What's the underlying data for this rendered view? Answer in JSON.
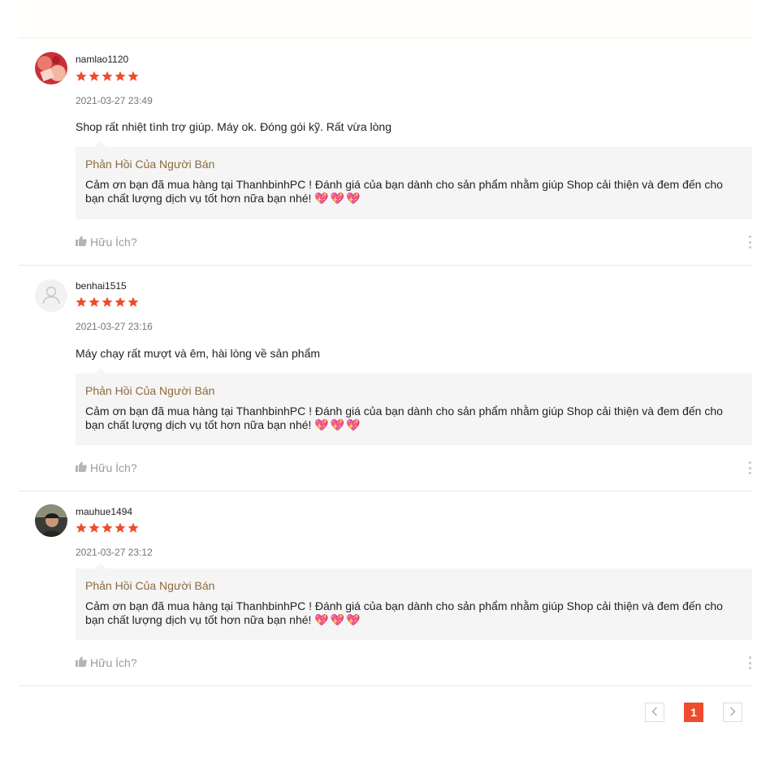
{
  "reviews": [
    {
      "username": "namlao1120",
      "rating": 5,
      "time": "2021-03-27 23:49",
      "comment": "Shop rất nhiệt tình trợ giúp. Máy ok. Đóng gói kỹ. Rất vừa lòng",
      "reply_title": "Phản Hồi Của Người Bán",
      "reply_text": "Cảm ơn bạn đã mua hàng tại ThanhbinhPC ! Đánh giá của bạn dành cho sản phẩm nhằm giúp Shop cải thiện và đem đến cho bạn chất lượng dịch vụ tốt hơn nữa bạn nhé!",
      "reply_emoji": "💖💖💖",
      "helpful_label": "Hữu Ích?"
    },
    {
      "username": "benhai1515",
      "rating": 5,
      "time": "2021-03-27 23:16",
      "comment": "Máy chạy rất mượt và êm, hài lòng về sản phẩm",
      "reply_title": "Phản Hồi Của Người Bán",
      "reply_text": "Cảm ơn bạn đã mua hàng tại ThanhbinhPC ! Đánh giá của bạn dành cho sản phẩm nhằm giúp Shop cải thiện và đem đến cho bạn chất lượng dịch vụ tốt hơn nữa bạn nhé!",
      "reply_emoji": "💖💖💖",
      "helpful_label": "Hữu Ích?"
    },
    {
      "username": "mauhue1494",
      "rating": 5,
      "time": "2021-03-27 23:12",
      "comment": "",
      "reply_title": "Phản Hồi Của Người Bán",
      "reply_text": "Cảm ơn bạn đã mua hàng tại ThanhbinhPC ! Đánh giá của bạn dành cho sản phẩm nhằm giúp Shop cải thiện và đem đến cho bạn chất lượng dịch vụ tốt hơn nữa bạn nhé!",
      "reply_emoji": "💖💖💖",
      "helpful_label": "Hữu Ích?"
    }
  ],
  "pagination": {
    "current_page": "1",
    "prev_icon": "chevron-left-icon",
    "next_icon": "chevron-right-icon"
  },
  "colors": {
    "star": "#ee4d2d",
    "accent": "#ee4d2d",
    "reply_title": "#8b6a3e",
    "reply_bg": "#f5f5f5"
  }
}
